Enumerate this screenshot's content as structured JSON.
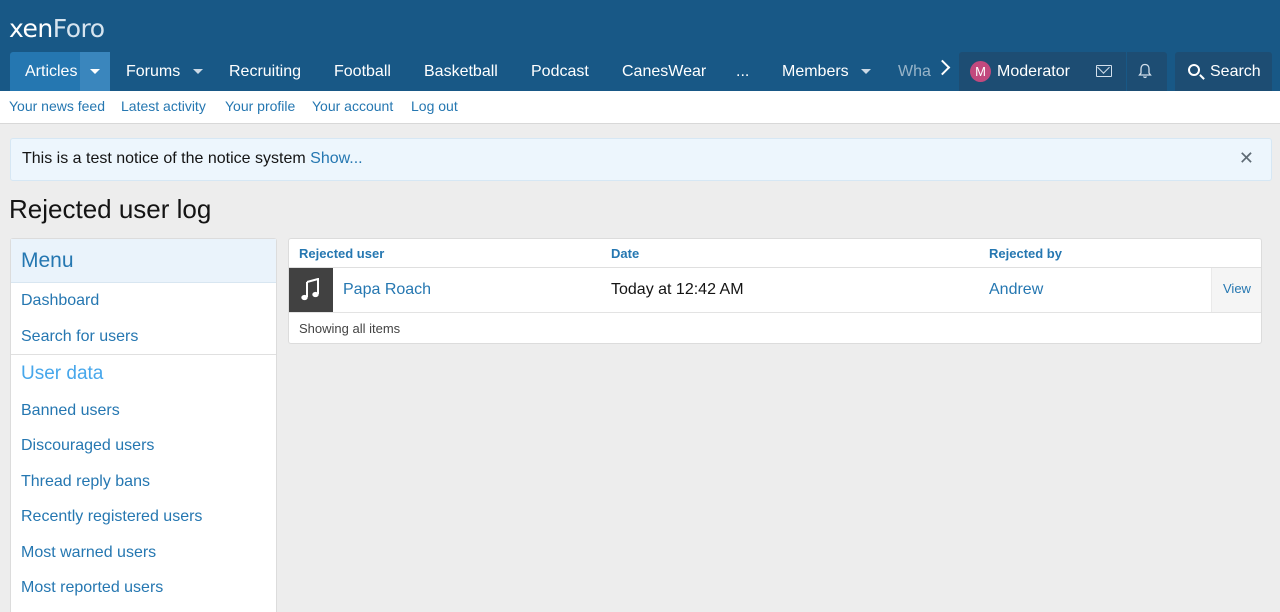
{
  "logo": {
    "part1": "xen",
    "part2": "Foro"
  },
  "nav": {
    "items": [
      {
        "label": "Articles"
      },
      {
        "label": "Forums"
      },
      {
        "label": "Recruiting"
      },
      {
        "label": "Football"
      },
      {
        "label": "Basketball"
      },
      {
        "label": "Podcast"
      },
      {
        "label": "CanesWear"
      },
      {
        "label": "..."
      },
      {
        "label": "Members"
      },
      {
        "label": "Wha"
      }
    ],
    "user": {
      "avatar_letter": "M",
      "name": "Moderator"
    },
    "search_label": "Search"
  },
  "subnav": {
    "items": [
      {
        "label": "Your news feed"
      },
      {
        "label": "Latest activity"
      },
      {
        "label": "Your profile"
      },
      {
        "label": "Your account"
      },
      {
        "label": "Log out"
      }
    ]
  },
  "notice": {
    "text": "This is a test notice of the notice system",
    "link": "Show...",
    "close": "✕"
  },
  "page": {
    "title": "Rejected user log"
  },
  "sidebar": {
    "header": "Menu",
    "top_links": [
      {
        "label": "Dashboard"
      },
      {
        "label": "Search for users"
      }
    ],
    "section_title": "User data",
    "section_links": [
      {
        "label": "Banned users"
      },
      {
        "label": "Discouraged users"
      },
      {
        "label": "Thread reply bans"
      },
      {
        "label": "Recently registered users"
      },
      {
        "label": "Most warned users"
      },
      {
        "label": "Most reported users"
      }
    ]
  },
  "table": {
    "columns": [
      "Rejected user",
      "Date",
      "Rejected by"
    ],
    "rows": [
      {
        "user": "Papa Roach",
        "date": "Today at 12:42 AM",
        "rejected_by": "Andrew",
        "action": "View"
      }
    ],
    "footer": "Showing all items"
  },
  "colors": {
    "header_bg": "#185886",
    "link": "#2577b1",
    "accent": "#47a7eb"
  }
}
